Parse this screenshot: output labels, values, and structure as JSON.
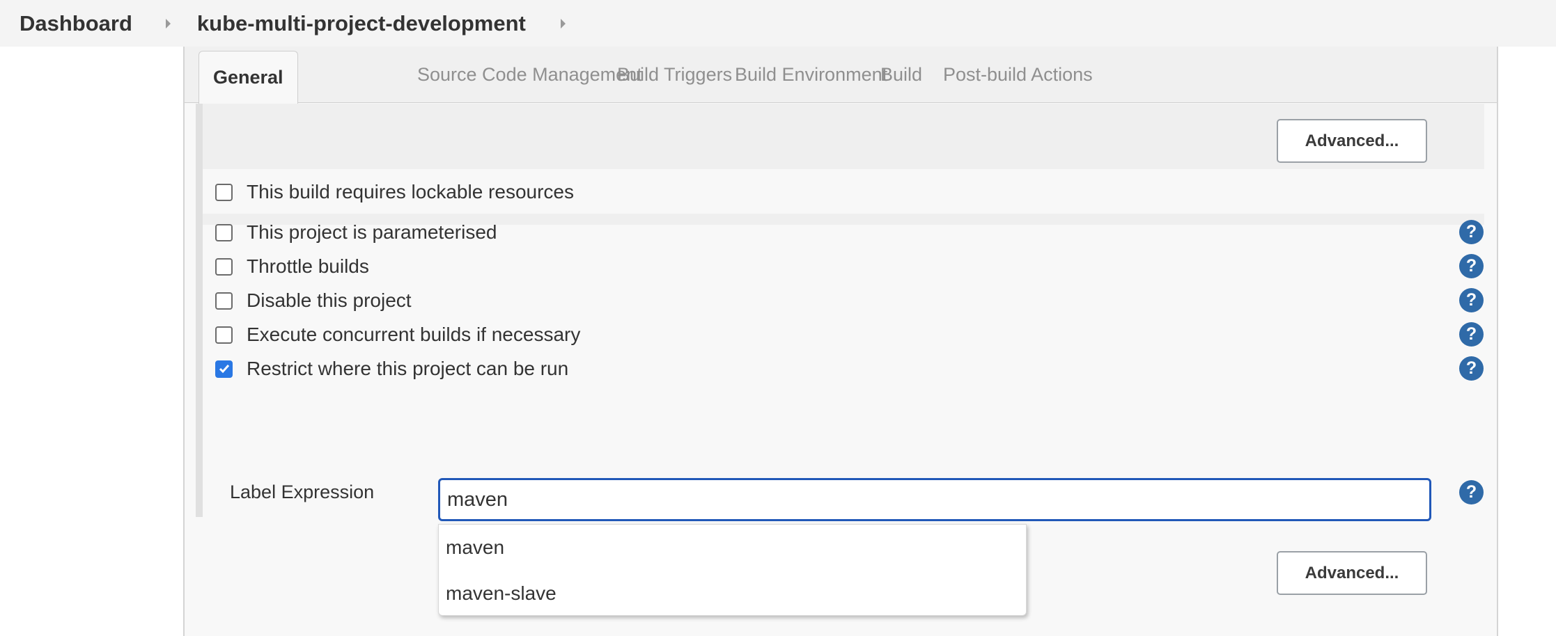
{
  "breadcrumb": {
    "items": [
      "Dashboard",
      "kube-multi-project-development"
    ]
  },
  "tabs": [
    {
      "label": "General",
      "active": true
    },
    {
      "label": "Source Code Management",
      "active": false
    },
    {
      "label": "Build Triggers",
      "active": false
    },
    {
      "label": "Build Environment",
      "active": false
    },
    {
      "label": "Build",
      "active": false
    },
    {
      "label": "Post-build Actions",
      "active": false
    }
  ],
  "buttons": {
    "advanced_top": "Advanced...",
    "advanced_bottom": "Advanced..."
  },
  "options": [
    {
      "label": "This build requires lockable resources",
      "checked": false,
      "help": false
    },
    {
      "label": "This project is parameterised",
      "checked": false,
      "help": true
    },
    {
      "label": "Throttle builds",
      "checked": false,
      "help": true
    },
    {
      "label": "Disable this project",
      "checked": false,
      "help": true
    },
    {
      "label": "Execute concurrent builds if necessary",
      "checked": false,
      "help": true
    },
    {
      "label": "Restrict where this project can be run",
      "checked": true,
      "help": true
    }
  ],
  "label_expression": {
    "label": "Label Expression",
    "value": "maven",
    "suggestions": [
      "maven",
      "maven-slave"
    ]
  },
  "help_icon_glyph": "?",
  "colors": {
    "accent": "#2a78e4",
    "help": "#2f6aa8",
    "input_border": "#2158b8"
  }
}
